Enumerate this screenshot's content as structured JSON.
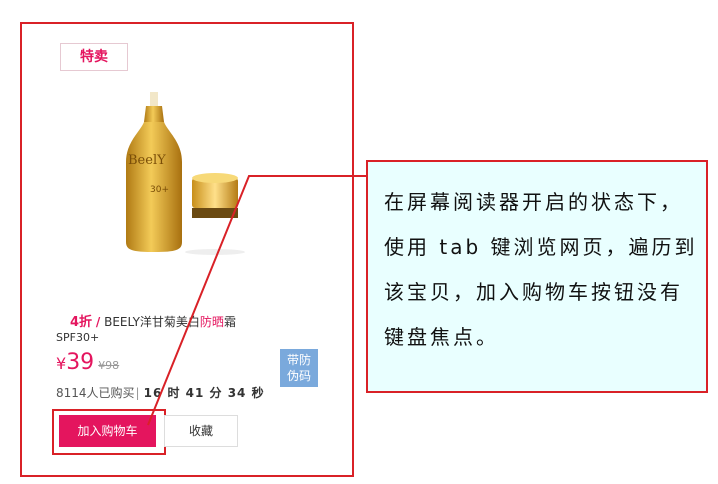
{
  "card": {
    "badge": "特卖",
    "discount": "4折",
    "separator": "/",
    "title_before": "BEELY洋甘菊美白",
    "title_highlight": "防晒",
    "title_after": "霜",
    "subtitle": "SPF30+",
    "price_symbol": "¥",
    "price": "39",
    "original_price": "¥98",
    "authentic_line1": "带防",
    "authentic_line2": "伪码",
    "buyers": "8114人已购买",
    "countdown": "16 时 41 分 34 秒",
    "buy_button": "加入购物车",
    "favorite_button": "收藏",
    "product_brand": "BeelY",
    "product_spf": "30+"
  },
  "callout": {
    "text": "在屏幕阅读器开启的状态下，使用 tab 键浏览网页，遍历到该宝贝，加入购物车按钮没有键盘焦点。"
  },
  "colors": {
    "accent": "#e4155e",
    "annotation_red": "#d92127",
    "callout_bg": "#e9ffff",
    "authentic_bg": "#7aa9dc",
    "bottle_gold": "#d6a12a"
  }
}
